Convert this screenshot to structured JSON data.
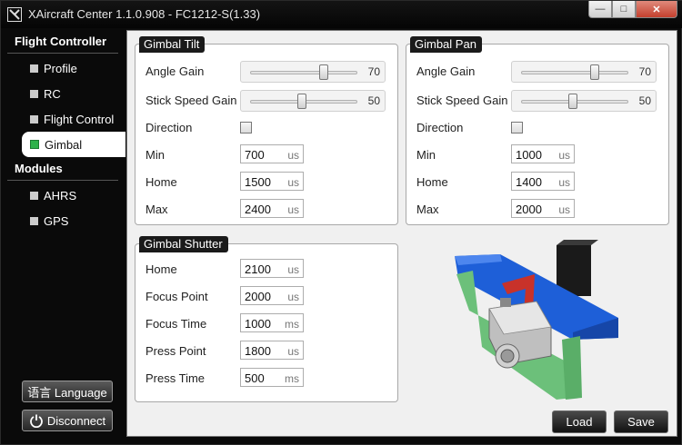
{
  "window": {
    "title": "XAircraft Center 1.1.0.908 - FC1212-S(1.33)"
  },
  "sidebar": {
    "flight_controller_title": "Flight Controller",
    "fc_items": [
      {
        "label": "Profile"
      },
      {
        "label": "RC"
      },
      {
        "label": "Flight Control"
      },
      {
        "label": "Gimbal"
      }
    ],
    "modules_title": "Modules",
    "module_items": [
      {
        "label": "AHRS"
      },
      {
        "label": "GPS"
      }
    ],
    "language_label": "语言 Language",
    "disconnect_label": "Disconnect"
  },
  "gimbal_tilt": {
    "title": "Gimbal Tilt",
    "angle_gain_label": "Angle Gain",
    "angle_gain_value": "70",
    "stick_speed_gain_label": "Stick Speed Gain",
    "stick_speed_gain_value": "50",
    "direction_label": "Direction",
    "min_label": "Min",
    "min_value": "700",
    "min_unit": "us",
    "home_label": "Home",
    "home_value": "1500",
    "home_unit": "us",
    "max_label": "Max",
    "max_value": "2400",
    "max_unit": "us"
  },
  "gimbal_pan": {
    "title": "Gimbal Pan",
    "angle_gain_label": "Angle Gain",
    "angle_gain_value": "70",
    "stick_speed_gain_label": "Stick Speed Gain",
    "stick_speed_gain_value": "50",
    "direction_label": "Direction",
    "min_label": "Min",
    "min_value": "1000",
    "min_unit": "us",
    "home_label": "Home",
    "home_value": "1400",
    "home_unit": "us",
    "max_label": "Max",
    "max_value": "2000",
    "max_unit": "us"
  },
  "gimbal_shutter": {
    "title": "Gimbal Shutter",
    "home_label": "Home",
    "home_value": "2100",
    "home_unit": "us",
    "focus_point_label": "Focus Point",
    "focus_point_value": "2000",
    "focus_point_unit": "us",
    "focus_time_label": "Focus Time",
    "focus_time_value": "1000",
    "focus_time_unit": "ms",
    "press_point_label": "Press Point",
    "press_point_value": "1800",
    "press_point_unit": "us",
    "press_time_label": "Press Time",
    "press_time_value": "500",
    "press_time_unit": "ms"
  },
  "actions": {
    "load_label": "Load",
    "save_label": "Save"
  },
  "colors": {
    "active_indicator": "#2db24a",
    "frame_blue": "#1e5fd8",
    "frame_green": "#6cc07a",
    "camera_mount_red": "#c8322a"
  }
}
